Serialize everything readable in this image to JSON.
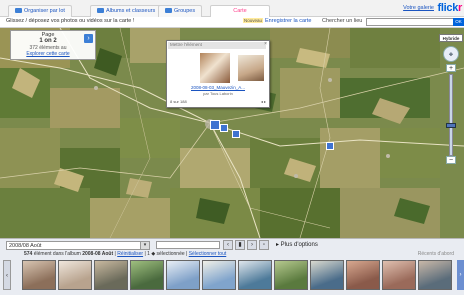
{
  "tabs": [
    {
      "label": "Organiser par lot"
    },
    {
      "label": "Albums et classeurs"
    },
    {
      "label": "Groupes"
    },
    {
      "label": "Carte",
      "active": true
    }
  ],
  "account": {
    "link": "Votre galerie"
  },
  "logo": {
    "part1": "flick",
    "part2": "r"
  },
  "helpbar": {
    "instructions": "Glissez / déposez vos photos ou vidéos sur la carte !",
    "save_badge": "Nouveau",
    "save_label": "Enregistrer la carte",
    "find_label": "Chercher un lieu",
    "find_placeholder": "",
    "find_button": "OK"
  },
  "pager": {
    "label": "Page",
    "value": "1 on 2",
    "count": "372 éléments au",
    "explore": "Explorer cette carte",
    "next": "›"
  },
  "popup": {
    "title": "Mettre l'élément",
    "close": "×",
    "caption": "2008-08-03_Mauvezin_A...",
    "byline": "par Tous Laborin",
    "footer_left": "8 sur 188",
    "footer_right": "◂ ▸"
  },
  "map_controls": {
    "hybrid": "Hybride",
    "pan": "✥",
    "zoom_in": "+",
    "zoom_out": "−"
  },
  "bottom": {
    "batch_select": "2008/08 Août",
    "more_options": "▸ Plus d'options",
    "count_text": "574",
    "count_suffix": "élément dans l'album",
    "album_name": "2008-08 Août",
    "links": [
      "Réinitialiser",
      "Sélectionner tout"
    ],
    "selected": "1 ◆ sélectionnée",
    "recent_label": "Récents d'abord"
  },
  "thumbnails": [
    {
      "colors": [
        "#8c6f5a",
        "#d8c5b2"
      ]
    },
    {
      "colors": [
        "#b8a38e",
        "#efe6dc"
      ]
    },
    {
      "colors": [
        "#6a6a5a",
        "#c9b9a0"
      ]
    },
    {
      "colors": [
        "#4a6a3e",
        "#9fbf7f"
      ]
    },
    {
      "colors": [
        "#7ea0c8",
        "#e8eef5"
      ]
    },
    {
      "colors": [
        "#80a4cc",
        "#f0f0e8"
      ]
    },
    {
      "colors": [
        "#4d7a9a",
        "#dfe6ec"
      ]
    },
    {
      "colors": [
        "#5a7a3e",
        "#b6c98f"
      ]
    },
    {
      "colors": [
        "#4a6c8a",
        "#d9d9cf"
      ]
    },
    {
      "colors": [
        "#8a5a4a",
        "#d8a890"
      ]
    },
    {
      "colors": [
        "#9a6a5a",
        "#e0c0b0"
      ]
    },
    {
      "colors": [
        "#5a6c7a",
        "#c9b8a8"
      ]
    }
  ],
  "colors": {
    "accent": "#0063dc",
    "pink": "#ff0084",
    "map_base": "#7a8a4a"
  }
}
